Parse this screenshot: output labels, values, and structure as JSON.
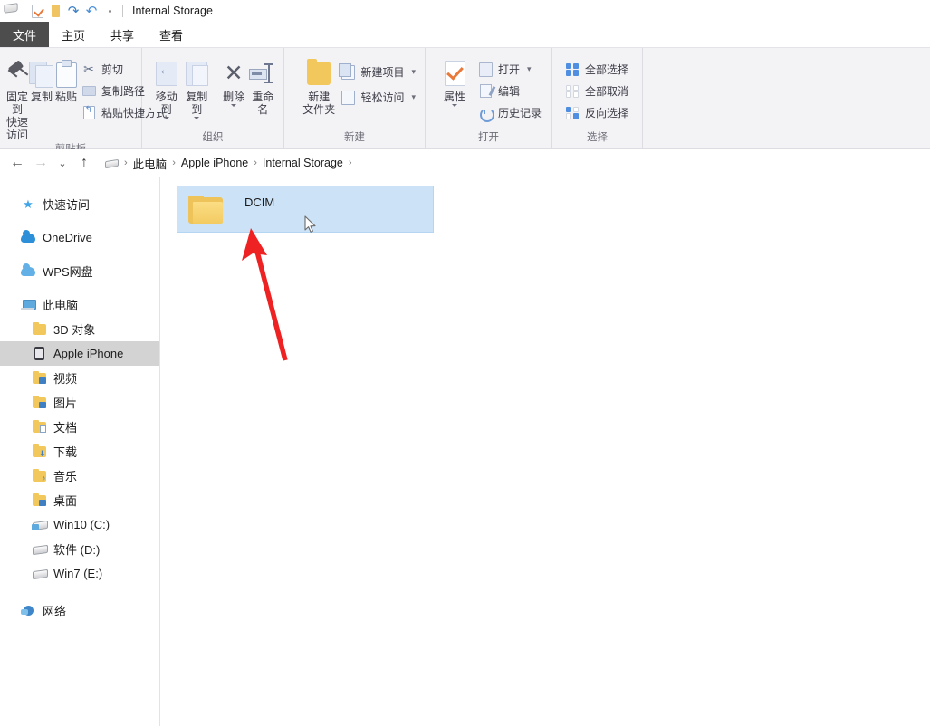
{
  "window": {
    "title": "Internal Storage"
  },
  "quick_access_toolbar": {
    "items": [
      {
        "name": "device-icon",
        "label": ""
      },
      {
        "name": "properties-icon",
        "label": ""
      },
      {
        "name": "new-folder-icon",
        "label": ""
      },
      {
        "name": "redo-icon",
        "label": "↷"
      },
      {
        "name": "undo-icon",
        "label": "↶"
      },
      {
        "name": "customize-icon",
        "label": ""
      }
    ]
  },
  "ribbon": {
    "tabs": [
      {
        "label": "文件",
        "state": "file"
      },
      {
        "label": "主页",
        "state": "active"
      },
      {
        "label": "共享",
        "state": "normal"
      },
      {
        "label": "查看",
        "state": "normal"
      }
    ],
    "groups": [
      {
        "label": "剪贴板",
        "big_buttons": [
          {
            "label": "固定到\n快速访问",
            "icon": "pin-icon"
          },
          {
            "label": "复制",
            "icon": "copy-icon"
          },
          {
            "label": "粘贴",
            "icon": "paste-icon",
            "caret": true
          }
        ],
        "small_buttons": [
          {
            "label": "剪切",
            "icon": "scissors-icon"
          },
          {
            "label": "复制路径",
            "icon": "copy-path-icon"
          },
          {
            "label": "粘贴快捷方式",
            "icon": "paste-shortcut-icon"
          }
        ]
      },
      {
        "label": "组织",
        "big_buttons": [
          {
            "label": "移动到",
            "icon": "move-to-icon",
            "caret": true
          },
          {
            "label": "复制到",
            "icon": "copy-to-icon",
            "caret": true
          },
          {
            "label": "删除",
            "icon": "delete-icon",
            "caret": true
          },
          {
            "label": "重命名",
            "icon": "rename-icon"
          }
        ],
        "small_buttons": []
      },
      {
        "label": "新建",
        "big_buttons": [
          {
            "label": "新建\n文件夹",
            "icon": "new-folder-icon"
          }
        ],
        "small_buttons": [
          {
            "label": "新建项目",
            "icon": "new-item-icon",
            "caret": true
          },
          {
            "label": "轻松访问",
            "icon": "easy-access-icon",
            "caret": true
          }
        ]
      },
      {
        "label": "打开",
        "big_buttons": [
          {
            "label": "属性",
            "icon": "properties-icon",
            "caret": true
          }
        ],
        "small_buttons": [
          {
            "label": "打开",
            "icon": "open-icon",
            "caret": true
          },
          {
            "label": "编辑",
            "icon": "edit-icon"
          },
          {
            "label": "历史记录",
            "icon": "history-icon"
          }
        ]
      },
      {
        "label": "选择",
        "big_buttons": [],
        "small_buttons": [
          {
            "label": "全部选择",
            "icon": "select-all-icon"
          },
          {
            "label": "全部取消",
            "icon": "select-none-icon"
          },
          {
            "label": "反向选择",
            "icon": "invert-selection-icon"
          }
        ]
      }
    ]
  },
  "address_bar": {
    "back_label": "←",
    "forward_label": "→",
    "recent_label": "⌄",
    "up_label": "↑",
    "crumbs": [
      {
        "label": "此电脑"
      },
      {
        "label": "Apple iPhone"
      },
      {
        "label": "Internal Storage"
      }
    ],
    "separator": "›"
  },
  "nav_pane": {
    "items": [
      {
        "label": "快速访问",
        "icon": "star-icon",
        "level": 0,
        "selected": false
      },
      {
        "label": "OneDrive",
        "icon": "cloud-icon",
        "level": 0,
        "selected": false
      },
      {
        "label": "WPS网盘",
        "icon": "wps-cloud-icon",
        "level": 0,
        "selected": false
      },
      {
        "label": "此电脑",
        "icon": "this-pc-icon",
        "level": 0,
        "selected": false
      },
      {
        "label": "3D 对象",
        "icon": "folder-3d-icon",
        "level": 1,
        "selected": false
      },
      {
        "label": "Apple iPhone",
        "icon": "phone-icon",
        "level": 1,
        "selected": true
      },
      {
        "label": "视频",
        "icon": "folder-videos-icon",
        "level": 1,
        "selected": false
      },
      {
        "label": "图片",
        "icon": "folder-pictures-icon",
        "level": 1,
        "selected": false
      },
      {
        "label": "文档",
        "icon": "folder-documents-icon",
        "level": 1,
        "selected": false
      },
      {
        "label": "下载",
        "icon": "folder-downloads-icon",
        "level": 1,
        "selected": false
      },
      {
        "label": "音乐",
        "icon": "folder-music-icon",
        "level": 1,
        "selected": false
      },
      {
        "label": "桌面",
        "icon": "folder-desktop-icon",
        "level": 1,
        "selected": false
      },
      {
        "label": "Win10 (C:)",
        "icon": "system-drive-icon",
        "level": 1,
        "selected": false
      },
      {
        "label": "软件 (D:)",
        "icon": "drive-icon",
        "level": 1,
        "selected": false
      },
      {
        "label": "Win7 (E:)",
        "icon": "drive-icon",
        "level": 1,
        "selected": false
      },
      {
        "label": "网络",
        "icon": "network-icon",
        "level": 0,
        "selected": false
      }
    ]
  },
  "content": {
    "items": [
      {
        "name": "DCIM",
        "icon": "folder-icon",
        "selected": true
      }
    ]
  },
  "annotation": {
    "arrow_color": "#ee2222",
    "description": "red arrow pointing at DCIM folder"
  },
  "colors": {
    "selection_blue": "#cce3f7",
    "nav_selection_gray": "#d3d3d3",
    "ribbon_bg": "#f3f3f6",
    "file_tab": "#4d4d4d",
    "folder_yellow": "#f2c75c",
    "accent_orange": "#e8793a"
  }
}
